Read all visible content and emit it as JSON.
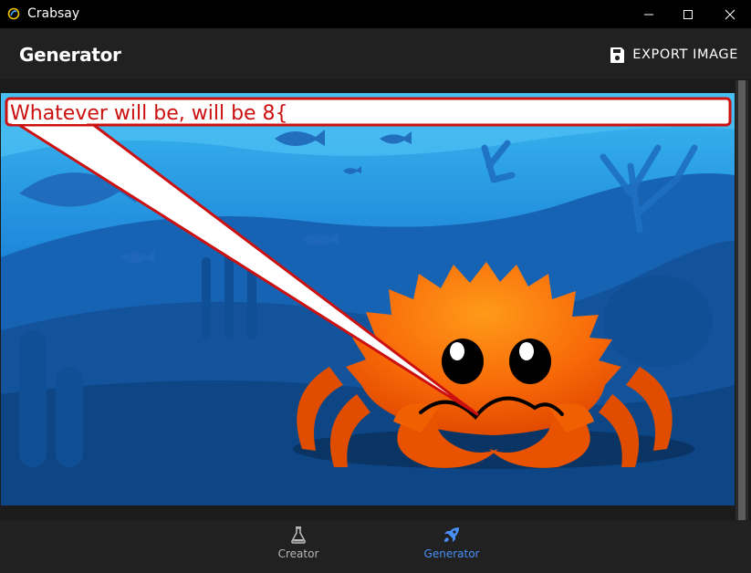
{
  "window": {
    "title": "Crabsay",
    "controls": [
      "minimize-icon",
      "maximize-icon",
      "close-icon"
    ]
  },
  "appbar": {
    "title": "Generator",
    "export_label": "EXPORT IMAGE",
    "export_icon": "save-icon"
  },
  "canvas": {
    "speech_text": "Whatever will be, will be 8{",
    "speech_color": "#cc1010",
    "crab_color": "#f35a00",
    "sea_color": "#1a73c7"
  },
  "bottom_nav": {
    "items": [
      {
        "label": "Creator",
        "icon": "flask-icon",
        "active": false
      },
      {
        "label": "Generator",
        "icon": "rocket-icon",
        "active": true
      }
    ],
    "active_color": "#4a8ff7",
    "inactive_color": "#b8b8b8"
  }
}
